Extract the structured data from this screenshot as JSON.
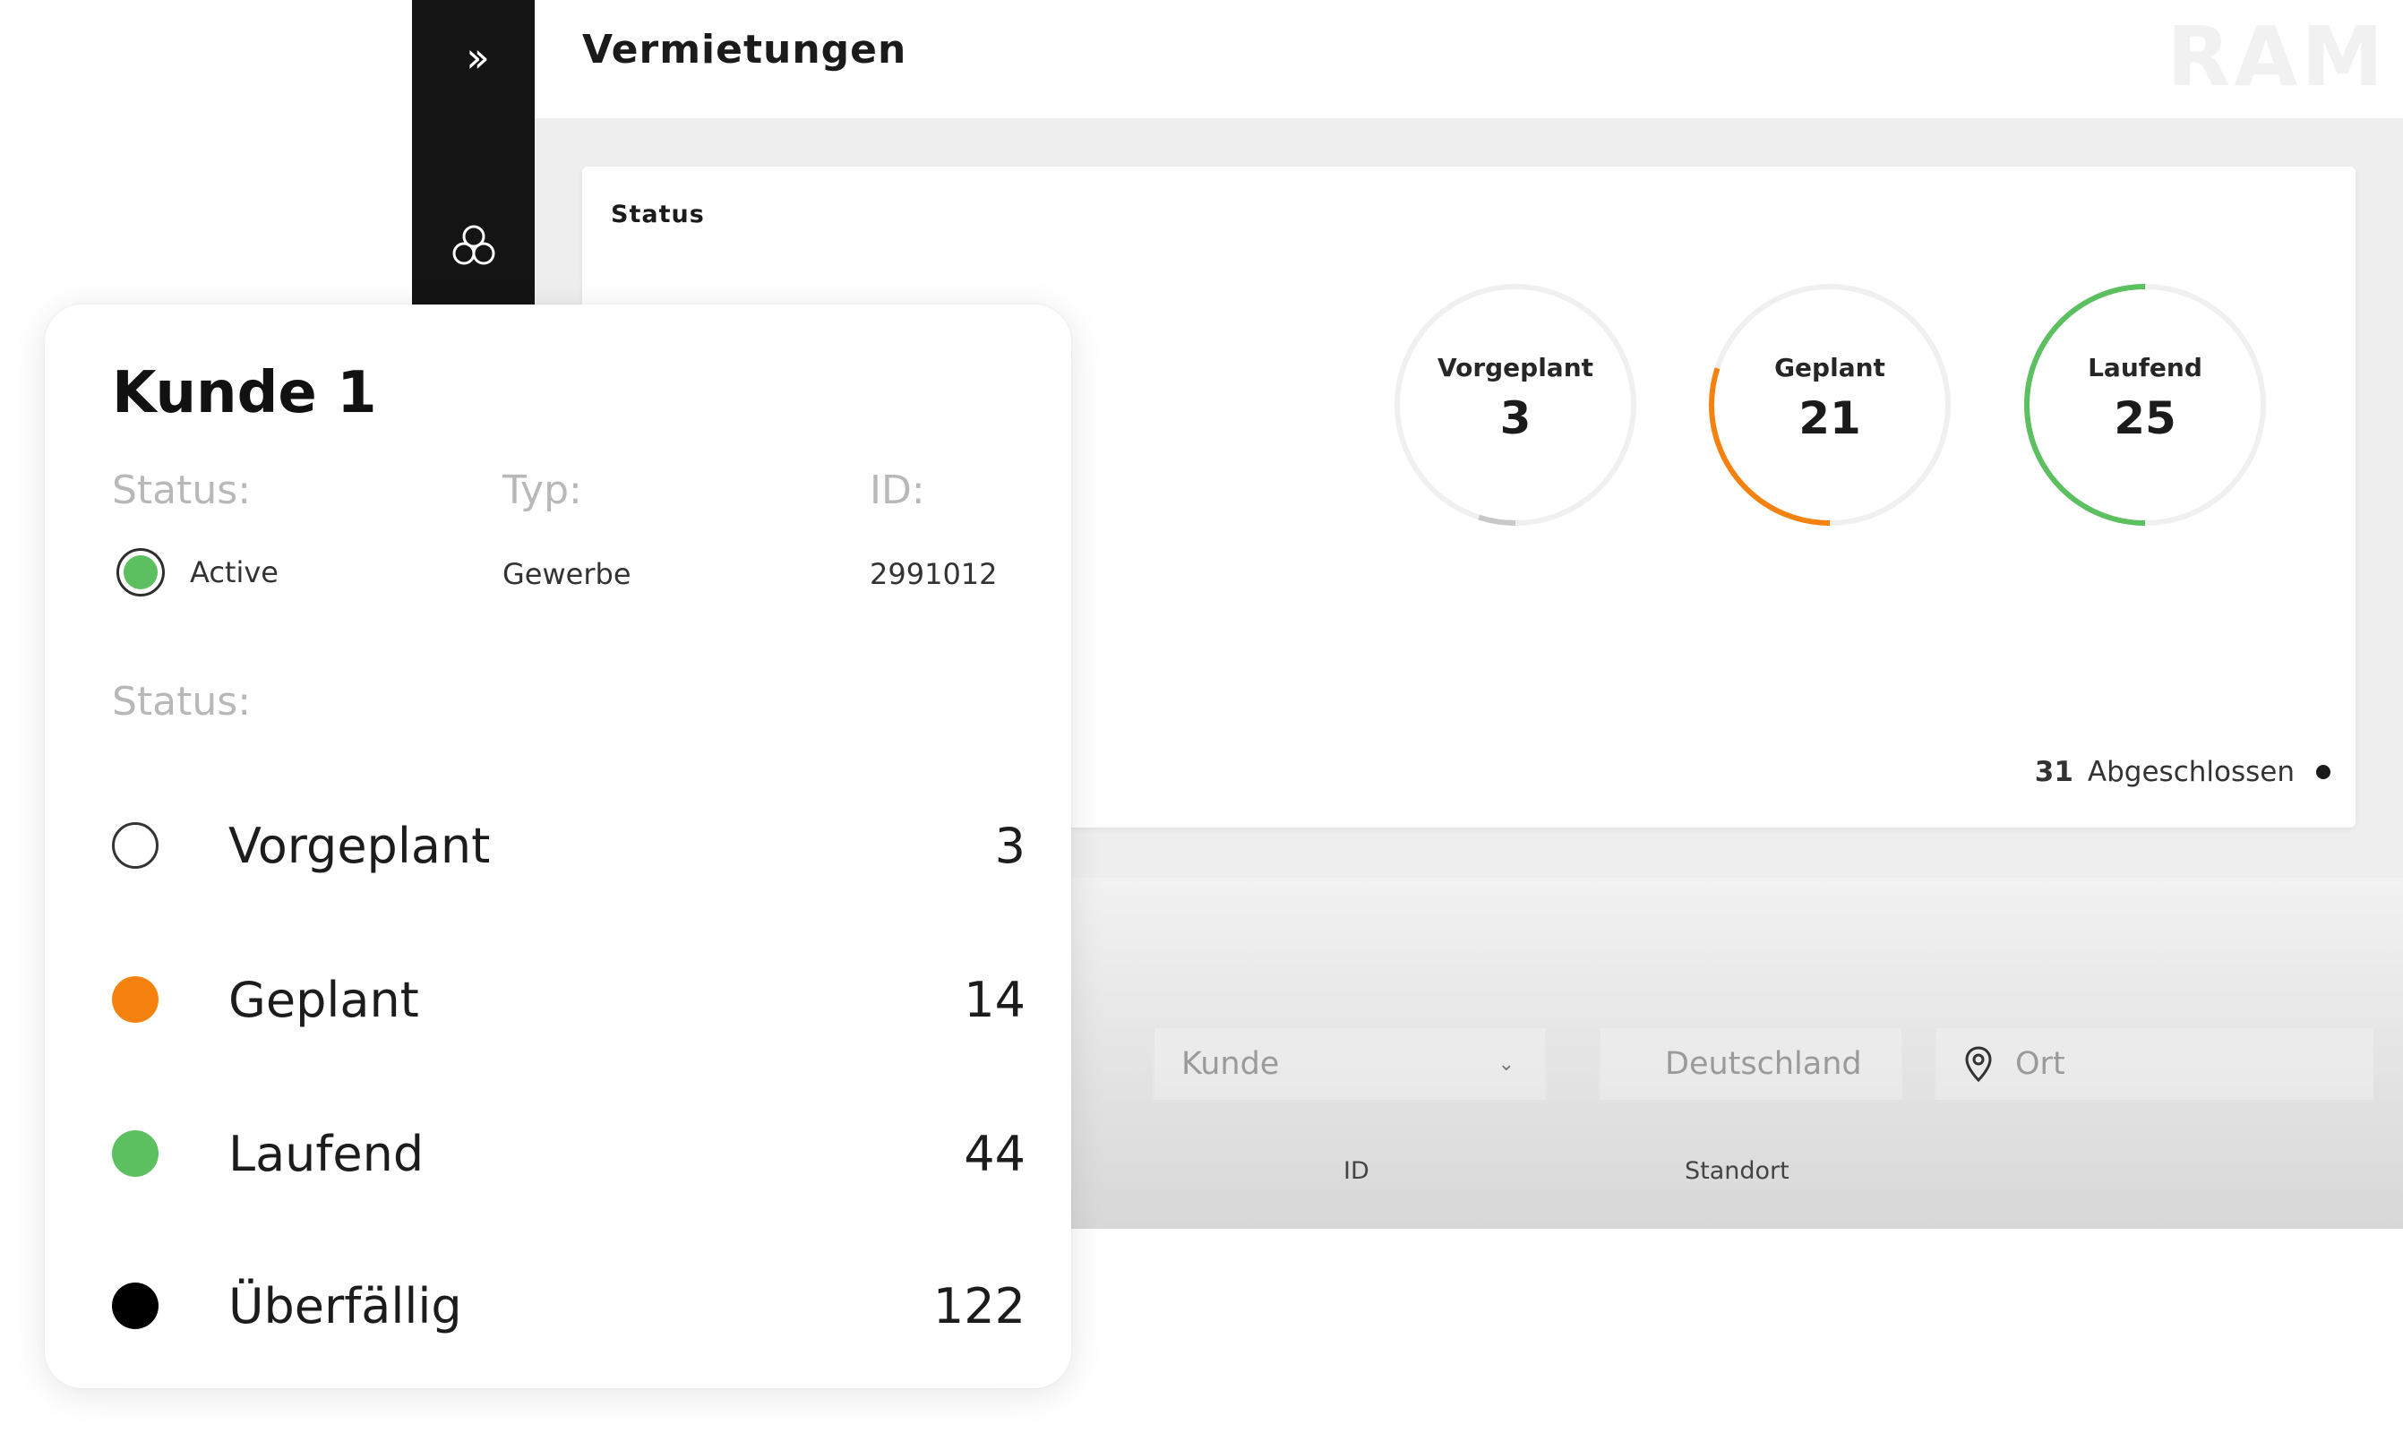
{
  "colors": {
    "sidebar_bg": "#141414",
    "vorgeplant": "#ffffff",
    "geplant": "#f5820f",
    "laufend": "#5cc060",
    "ueberfaellig": "#000000",
    "active": "#5cc060"
  },
  "sidebar": {
    "expand_icon": "double-chevron-right-icon",
    "nav_icon": "cluster-icon"
  },
  "header": {
    "title": "Vermietungen",
    "logo": "RAM"
  },
  "status_card": {
    "title": "Status",
    "rings": [
      {
        "label": "Vorgeplant",
        "value": "3",
        "fraction": 0.05
      },
      {
        "label": "Geplant",
        "value": "21",
        "fraction": 0.3
      },
      {
        "label": "Laufend",
        "value": "25",
        "fraction": 0.5
      }
    ],
    "closed": {
      "count": "31",
      "label": "Abgeschlossen"
    }
  },
  "filters": {
    "kunde": {
      "value": "Kunde",
      "icon": "chevron-down-icon"
    },
    "land": {
      "value": "Deutschland"
    },
    "ort": {
      "placeholder": "Ort",
      "icon": "location-pin-icon"
    }
  },
  "table": {
    "columns": [
      "ID",
      "Standort"
    ]
  },
  "customer": {
    "name": "Kunde 1",
    "meta_labels": {
      "status": "Status:",
      "typ": "Typ:",
      "id": "ID:"
    },
    "status_value": "Active",
    "typ_value": "Gewerbe",
    "id_value": "2991012",
    "status_section_label": "Status:",
    "statuses": [
      {
        "label": "Vorgeplant",
        "count": "3"
      },
      {
        "label": "Geplant",
        "count": "14"
      },
      {
        "label": "Laufend",
        "count": "44"
      },
      {
        "label": "Überfällig",
        "count": "122"
      }
    ]
  }
}
